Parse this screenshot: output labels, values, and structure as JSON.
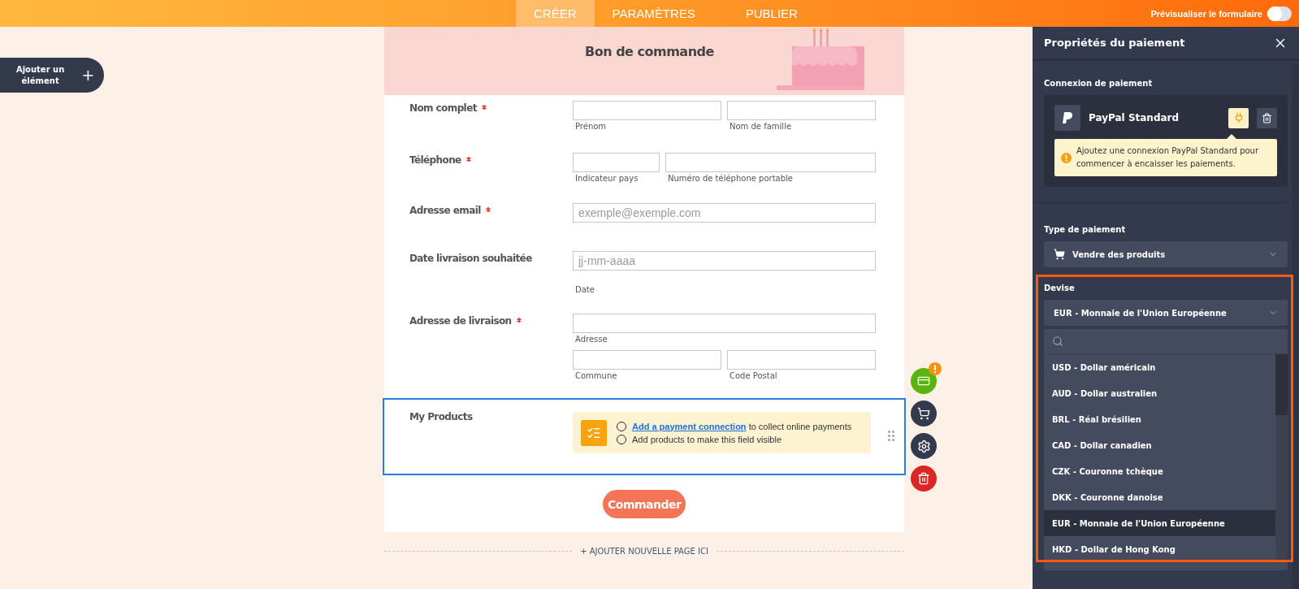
{
  "top_bar": {
    "tabs": [
      {
        "label": "CRÉER",
        "selected": true
      },
      {
        "label": "PARAMÈTRES",
        "selected": false
      },
      {
        "label": "PUBLIER",
        "selected": false
      }
    ],
    "preview_toggle": {
      "label": "Prévisualiser le formulaire",
      "on": false
    }
  },
  "add_element_button": {
    "label": "Ajouter un élément"
  },
  "form": {
    "title": "Bon de commande",
    "fields": [
      {
        "kind": "name",
        "label": "Nom complet",
        "required": true,
        "inputs": [
          {
            "sublabel": "Prénom"
          },
          {
            "sublabel": "Nom de famille"
          }
        ]
      },
      {
        "kind": "phone",
        "label": "Téléphone",
        "required": true,
        "inputs": [
          {
            "sublabel": "Indicateur pays"
          },
          {
            "sublabel": "Numéro de téléphone portable"
          }
        ]
      },
      {
        "kind": "email",
        "label": "Adresse email",
        "required": true,
        "inputs": [
          {
            "placeholder": "exemple@exemple.com"
          }
        ]
      },
      {
        "kind": "date",
        "label": "Date livraison souhaitée",
        "required": false,
        "inputs": [
          {
            "placeholder": "jj-mm-aaaa",
            "sublabel": "Date"
          }
        ]
      },
      {
        "kind": "address",
        "label": "Adresse de livraison",
        "required": true,
        "inputs": [
          {
            "sublabel": "Adresse"
          },
          {
            "sublabel": "Commune"
          },
          {
            "sublabel": "Code Postal"
          }
        ]
      }
    ],
    "products": {
      "label": "My Products",
      "selected": true,
      "steps": [
        {
          "link": "Add a payment connection",
          "text": "to collect online payments",
          "checked": false
        },
        {
          "text": "Add products to make this field visible",
          "checked": false
        }
      ]
    },
    "submit_button": "Commander"
  },
  "add_page": "+ AJOUTER NOUVELLE PAGE ICI",
  "panel": {
    "title": "Propriétés du paiement",
    "connection": {
      "heading": "Connexion de paiement",
      "name": "PayPal Standard",
      "warning": "Ajoutez une connexion PayPal Standard pour commencer à encaisser les paiements."
    },
    "payment_type": {
      "heading": "Type de paiement",
      "value": "Vendre des produits"
    },
    "currency": {
      "heading": "Devise",
      "value": "EUR - Monnaie de l'Union Européenne",
      "expanded": true,
      "options": [
        {
          "label": "USD - Dollar américain",
          "selected": false
        },
        {
          "label": "AUD - Dollar australien",
          "selected": false
        },
        {
          "label": "BRL - Réal brésilien",
          "selected": false
        },
        {
          "label": "CAD - Dollar canadien",
          "selected": false
        },
        {
          "label": "CZK - Couronne tchèque",
          "selected": false
        },
        {
          "label": "DKK - Couronne danoise",
          "selected": false
        },
        {
          "label": "EUR - Monnaie de l'Union Européenne",
          "selected": true
        },
        {
          "label": "HKD - Dollar de Hong Kong",
          "selected": false
        }
      ]
    }
  }
}
